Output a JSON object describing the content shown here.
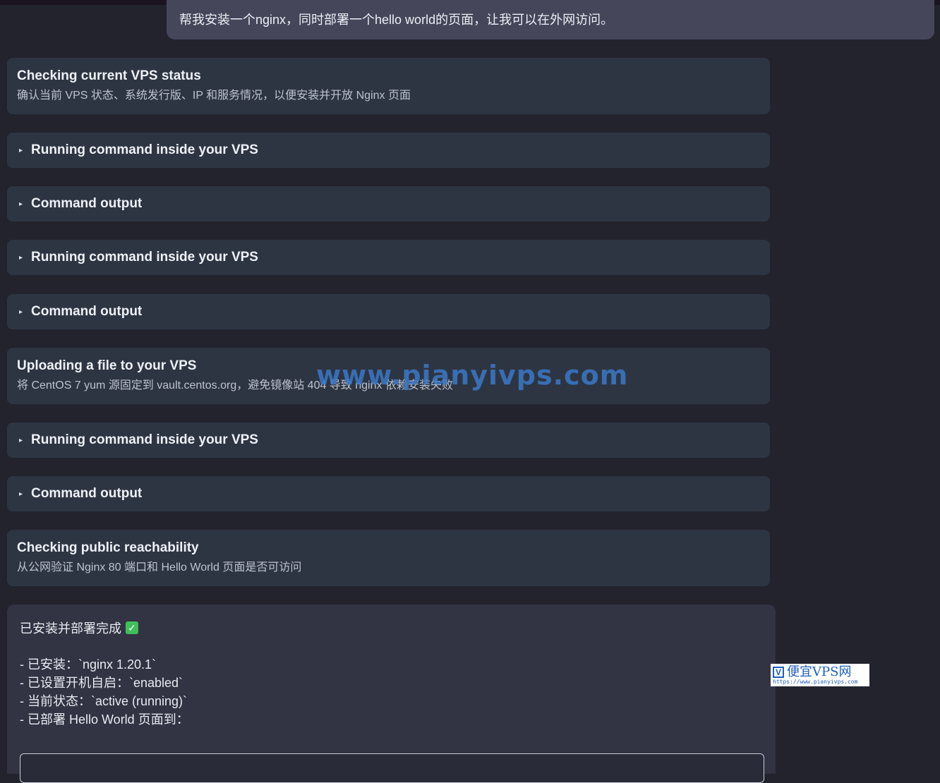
{
  "user_message": "帮我安装一个nginx，同时部署一个hello world的页面，让我可以在外网访问。",
  "steps": [
    {
      "type": "status",
      "title": "Checking current VPS status",
      "subtitle": "确认当前 VPS 状态、系统发行版、IP 和服务情况，以便安装并开放 Nginx 页面"
    },
    {
      "type": "collapsible",
      "label": "Running command inside your VPS"
    },
    {
      "type": "collapsible",
      "label": "Command output"
    },
    {
      "type": "collapsible",
      "label": "Running command inside your VPS"
    },
    {
      "type": "collapsible",
      "label": "Command output"
    },
    {
      "type": "status",
      "title": "Uploading a file to your VPS",
      "subtitle": "将 CentOS 7 yum 源固定到 vault.centos.org，避免镜像站 404 导致 nginx 依赖安装失败"
    },
    {
      "type": "collapsible",
      "label": "Running command inside your VPS"
    },
    {
      "type": "collapsible",
      "label": "Command output"
    },
    {
      "type": "status",
      "title": "Checking public reachability",
      "subtitle": "从公网验证 Nginx 80 端口和 Hello World 页面是否可访问"
    }
  ],
  "summary": {
    "heading": "已安装并部署完成",
    "lines": [
      "- 已安装：`nginx 1.20.1`",
      "- 已设置开机自启：`enabled`",
      "- 当前状态：`active (running)`",
      "- 已部署 Hello World 页面到："
    ]
  },
  "watermark": "www.pianyivps.com",
  "logo": {
    "name": "便宜VPS网",
    "url": "https://www.pianyivps.com"
  },
  "icons": {
    "collapse_caret": "caret-right-icon",
    "check": "check-mark-icon"
  }
}
